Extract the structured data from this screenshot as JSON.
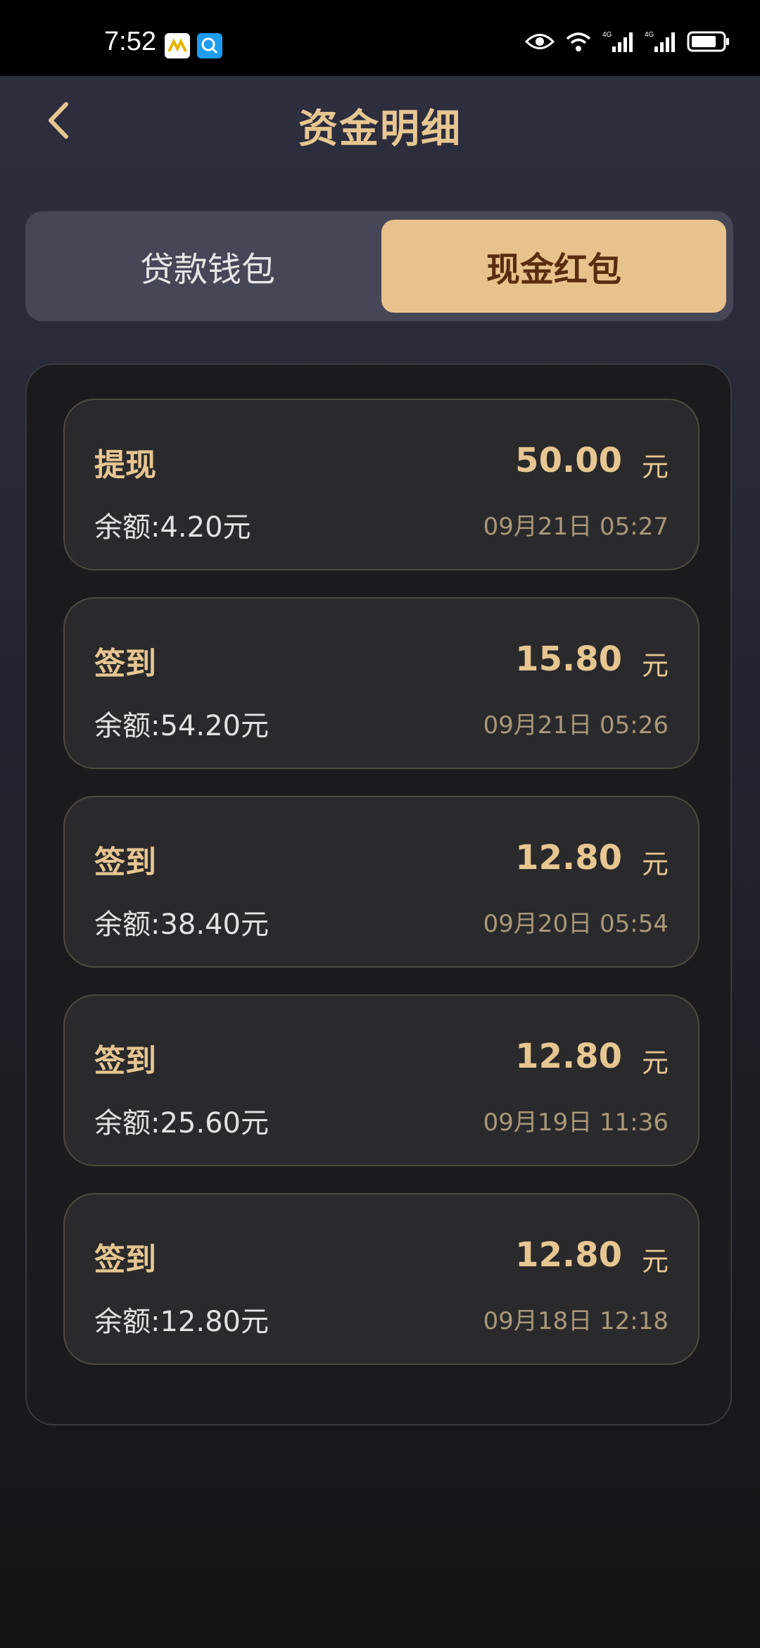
{
  "status_bar": {
    "time": "7:52",
    "icons": [
      "app-notification-icon",
      "search-app-icon",
      "eye-icon",
      "wifi-icon",
      "signal-4g-icon",
      "signal-4g-icon",
      "battery-icon"
    ],
    "network_label_1": "4G",
    "network_label_2": "4G"
  },
  "header": {
    "title": "资金明细",
    "back_icon": "chevron-left-icon"
  },
  "tabs": [
    {
      "label": "贷款钱包",
      "active": false
    },
    {
      "label": "现金红包",
      "active": true
    }
  ],
  "records": [
    {
      "type": "提现",
      "amount": "50.00",
      "unit": "元",
      "balance": "余额:4.20元",
      "time": "09月21日 05:27"
    },
    {
      "type": "签到",
      "amount": "15.80",
      "unit": "元",
      "balance": "余额:54.20元",
      "time": "09月21日 05:26"
    },
    {
      "type": "签到",
      "amount": "12.80",
      "unit": "元",
      "balance": "余额:38.40元",
      "time": "09月20日 05:54"
    },
    {
      "type": "签到",
      "amount": "12.80",
      "unit": "元",
      "balance": "余额:25.60元",
      "time": "09月19日 11:36"
    },
    {
      "type": "签到",
      "amount": "12.80",
      "unit": "元",
      "balance": "余额:12.80元",
      "time": "09月18日 12:18"
    }
  ],
  "colors": {
    "accent_gold": "#e7c691",
    "active_tab_bg": "#e8c28d",
    "active_tab_text": "#5a2c10",
    "card_bg": "#2a2a2c",
    "time_text": "#a9987a"
  }
}
